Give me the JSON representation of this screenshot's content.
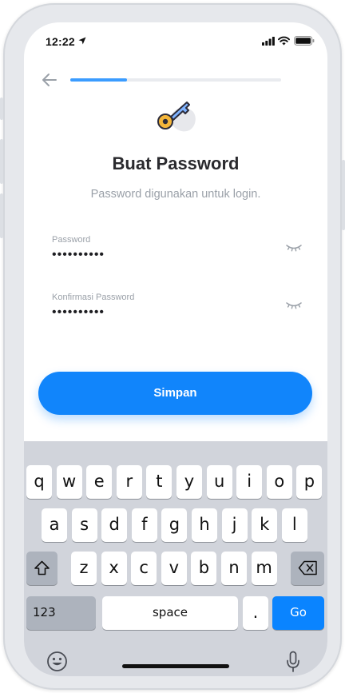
{
  "status_bar": {
    "time": "12:22"
  },
  "header": {
    "progress": 0.27
  },
  "content": {
    "title": "Buat Password",
    "subtitle": "Password digunakan untuk login."
  },
  "form": {
    "password": {
      "label": "Password",
      "value": "••••••••••"
    },
    "confirm": {
      "label": "Konfirmasi Password",
      "value": "••••••••••"
    }
  },
  "actions": {
    "save_label": "Simpan"
  },
  "keyboard": {
    "row1": [
      "q",
      "w",
      "e",
      "r",
      "t",
      "y",
      "u",
      "i",
      "o",
      "p"
    ],
    "row2": [
      "a",
      "s",
      "d",
      "f",
      "g",
      "h",
      "j",
      "k",
      "l"
    ],
    "row3": [
      "z",
      "x",
      "c",
      "v",
      "b",
      "n",
      "m"
    ],
    "numbers_label": "123",
    "space_label": "space",
    "period_label": ".",
    "go_label": "Go"
  },
  "colors": {
    "accent": "#1185fb",
    "progress": "#3b9cff",
    "go_key": "#0a84ff"
  }
}
